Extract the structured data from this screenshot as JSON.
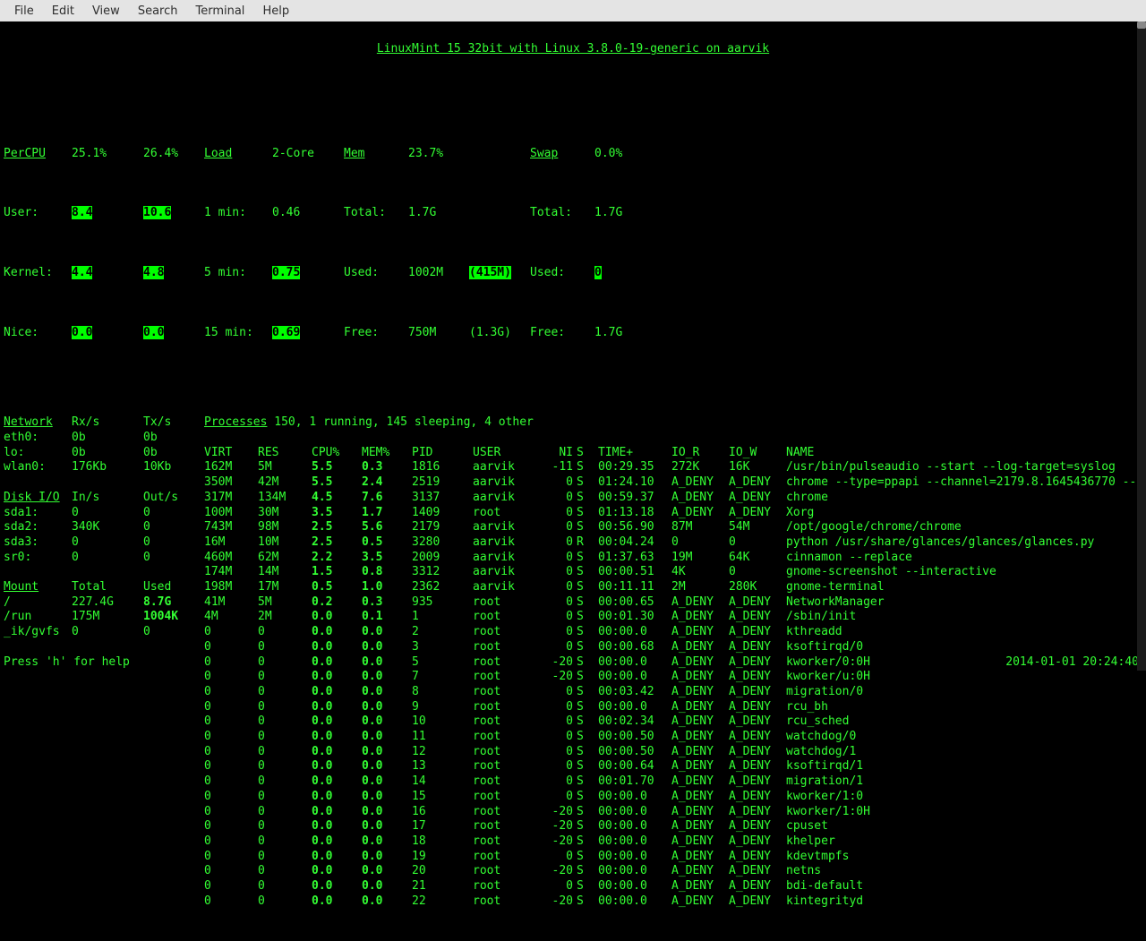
{
  "menu": [
    "File",
    "Edit",
    "View",
    "Search",
    "Terminal",
    "Help"
  ],
  "title": "LinuxMint 15 32bit with Linux 3.8.0-19-generic on aarvik",
  "percpu": {
    "header": "PerCPU",
    "cols": [
      "25.1%",
      "26.4%"
    ],
    "user_label": "User:",
    "user": [
      "8.4",
      "10.6"
    ],
    "kernel_label": "Kernel:",
    "kernel": [
      "4.4",
      "4.8"
    ],
    "nice_label": "Nice:",
    "nice": [
      "0.0",
      "0.0"
    ]
  },
  "load": {
    "header": "Load",
    "core": "2-Core",
    "l1_label": "1 min:",
    "l1": "0.46",
    "l5_label": "5 min:",
    "l5": "0.75",
    "l15_label": "15 min:",
    "l15": "0.69"
  },
  "mem": {
    "header": "Mem",
    "pct": "23.7%",
    "total_label": "Total:",
    "total": "1.7G",
    "used_label": "Used:",
    "used": "1002M",
    "used_paren": "(415M)",
    "free_label": "Free:",
    "free": "750M",
    "free_paren": "(1.3G)"
  },
  "swap": {
    "header": "Swap",
    "pct": "0.0%",
    "total_label": "Total:",
    "total": "1.7G",
    "used_label": "Used:",
    "used": "0",
    "free_label": "Free:",
    "free": "1.7G"
  },
  "network": {
    "header": "Network",
    "rx_label": "Rx/s",
    "tx_label": "Tx/s",
    "rows": [
      [
        "eth0:",
        "0b",
        "0b"
      ],
      [
        "lo:",
        "0b",
        "0b"
      ],
      [
        "wlan0:",
        "176Kb",
        "10Kb"
      ]
    ]
  },
  "diskio": {
    "header": "Disk I/O",
    "in_label": "In/s",
    "out_label": "Out/s",
    "rows": [
      [
        "sda1:",
        "0",
        "0"
      ],
      [
        "sda2:",
        "340K",
        "0"
      ],
      [
        "sda3:",
        "0",
        "0"
      ],
      [
        "sr0:",
        "0",
        "0"
      ]
    ]
  },
  "mount": {
    "header": "Mount",
    "total_label": "Total",
    "used_label": "Used",
    "rows": [
      [
        "/",
        "227.4G",
        "8.7G"
      ],
      [
        "/run",
        "175M",
        "1004K"
      ],
      [
        "_ik/gvfs",
        "0",
        "0"
      ]
    ]
  },
  "proc_summary": "Processes 150, 1 running, 145 sleeping, 4 other",
  "proc_header": [
    "VIRT",
    "RES",
    "CPU%",
    "MEM%",
    "PID",
    "USER",
    "NI",
    "S",
    "TIME+",
    "IO_R",
    "IO_W",
    "NAME"
  ],
  "procs": [
    [
      "162M",
      "5M",
      "5.5",
      "0.3",
      "1816",
      "aarvik",
      "-11",
      "S",
      "00:29.35",
      "272K",
      "16K",
      "/usr/bin/pulseaudio --start --log-target=syslog"
    ],
    [
      "350M",
      "42M",
      "5.5",
      "2.4",
      "2519",
      "aarvik",
      "0",
      "S",
      "01:24.10",
      "A_DENY",
      "A_DENY",
      "chrome --type=ppapi --channel=2179.8.1645436770 --"
    ],
    [
      "317M",
      "134M",
      "4.5",
      "7.6",
      "3137",
      "aarvik",
      "0",
      "S",
      "00:59.37",
      "A_DENY",
      "A_DENY",
      "chrome"
    ],
    [
      "100M",
      "30M",
      "3.5",
      "1.7",
      "1409",
      "root",
      "0",
      "S",
      "01:13.18",
      "A_DENY",
      "A_DENY",
      "Xorg"
    ],
    [
      "743M",
      "98M",
      "2.5",
      "5.6",
      "2179",
      "aarvik",
      "0",
      "S",
      "00:56.90",
      "87M",
      "54M",
      "/opt/google/chrome/chrome"
    ],
    [
      "16M",
      "10M",
      "2.5",
      "0.5",
      "3280",
      "aarvik",
      "0",
      "R",
      "00:04.24",
      "0",
      "0",
      "python /usr/share/glances/glances/glances.py"
    ],
    [
      "460M",
      "62M",
      "2.2",
      "3.5",
      "2009",
      "aarvik",
      "0",
      "S",
      "01:37.63",
      "19M",
      "64K",
      "cinnamon --replace"
    ],
    [
      "174M",
      "14M",
      "1.5",
      "0.8",
      "3312",
      "aarvik",
      "0",
      "S",
      "00:00.51",
      "4K",
      "0",
      "gnome-screenshot --interactive"
    ],
    [
      "198M",
      "17M",
      "0.5",
      "1.0",
      "2362",
      "aarvik",
      "0",
      "S",
      "00:11.11",
      "2M",
      "280K",
      "gnome-terminal"
    ],
    [
      "41M",
      "5M",
      "0.2",
      "0.3",
      "935",
      "root",
      "0",
      "S",
      "00:00.65",
      "A_DENY",
      "A_DENY",
      "NetworkManager"
    ],
    [
      "4M",
      "2M",
      "0.0",
      "0.1",
      "1",
      "root",
      "0",
      "S",
      "00:01.30",
      "A_DENY",
      "A_DENY",
      "/sbin/init"
    ],
    [
      "0",
      "0",
      "0.0",
      "0.0",
      "2",
      "root",
      "0",
      "S",
      "00:00.0",
      "A_DENY",
      "A_DENY",
      "kthreadd"
    ],
    [
      "0",
      "0",
      "0.0",
      "0.0",
      "3",
      "root",
      "0",
      "S",
      "00:00.68",
      "A_DENY",
      "A_DENY",
      "ksoftirqd/0"
    ],
    [
      "0",
      "0",
      "0.0",
      "0.0",
      "5",
      "root",
      "-20",
      "S",
      "00:00.0",
      "A_DENY",
      "A_DENY",
      "kworker/0:0H"
    ],
    [
      "0",
      "0",
      "0.0",
      "0.0",
      "7",
      "root",
      "-20",
      "S",
      "00:00.0",
      "A_DENY",
      "A_DENY",
      "kworker/u:0H"
    ],
    [
      "0",
      "0",
      "0.0",
      "0.0",
      "8",
      "root",
      "0",
      "S",
      "00:03.42",
      "A_DENY",
      "A_DENY",
      "migration/0"
    ],
    [
      "0",
      "0",
      "0.0",
      "0.0",
      "9",
      "root",
      "0",
      "S",
      "00:00.0",
      "A_DENY",
      "A_DENY",
      "rcu_bh"
    ],
    [
      "0",
      "0",
      "0.0",
      "0.0",
      "10",
      "root",
      "0",
      "S",
      "00:02.34",
      "A_DENY",
      "A_DENY",
      "rcu_sched"
    ],
    [
      "0",
      "0",
      "0.0",
      "0.0",
      "11",
      "root",
      "0",
      "S",
      "00:00.50",
      "A_DENY",
      "A_DENY",
      "watchdog/0"
    ],
    [
      "0",
      "0",
      "0.0",
      "0.0",
      "12",
      "root",
      "0",
      "S",
      "00:00.50",
      "A_DENY",
      "A_DENY",
      "watchdog/1"
    ],
    [
      "0",
      "0",
      "0.0",
      "0.0",
      "13",
      "root",
      "0",
      "S",
      "00:00.64",
      "A_DENY",
      "A_DENY",
      "ksoftirqd/1"
    ],
    [
      "0",
      "0",
      "0.0",
      "0.0",
      "14",
      "root",
      "0",
      "S",
      "00:01.70",
      "A_DENY",
      "A_DENY",
      "migration/1"
    ],
    [
      "0",
      "0",
      "0.0",
      "0.0",
      "15",
      "root",
      "0",
      "S",
      "00:00.0",
      "A_DENY",
      "A_DENY",
      "kworker/1:0"
    ],
    [
      "0",
      "0",
      "0.0",
      "0.0",
      "16",
      "root",
      "-20",
      "S",
      "00:00.0",
      "A_DENY",
      "A_DENY",
      "kworker/1:0H"
    ],
    [
      "0",
      "0",
      "0.0",
      "0.0",
      "17",
      "root",
      "-20",
      "S",
      "00:00.0",
      "A_DENY",
      "A_DENY",
      "cpuset"
    ],
    [
      "0",
      "0",
      "0.0",
      "0.0",
      "18",
      "root",
      "-20",
      "S",
      "00:00.0",
      "A_DENY",
      "A_DENY",
      "khelper"
    ],
    [
      "0",
      "0",
      "0.0",
      "0.0",
      "19",
      "root",
      "0",
      "S",
      "00:00.0",
      "A_DENY",
      "A_DENY",
      "kdevtmpfs"
    ],
    [
      "0",
      "0",
      "0.0",
      "0.0",
      "20",
      "root",
      "-20",
      "S",
      "00:00.0",
      "A_DENY",
      "A_DENY",
      "netns"
    ],
    [
      "0",
      "0",
      "0.0",
      "0.0",
      "21",
      "root",
      "0",
      "S",
      "00:00.0",
      "A_DENY",
      "A_DENY",
      "bdi-default"
    ],
    [
      "0",
      "0",
      "0.0",
      "0.0",
      "22",
      "root",
      "-20",
      "S",
      "00:00.0",
      "A_DENY",
      "A_DENY",
      "kintegrityd"
    ]
  ],
  "help": "Press 'h' for help",
  "clock": "2014-01-01 20:24:40"
}
